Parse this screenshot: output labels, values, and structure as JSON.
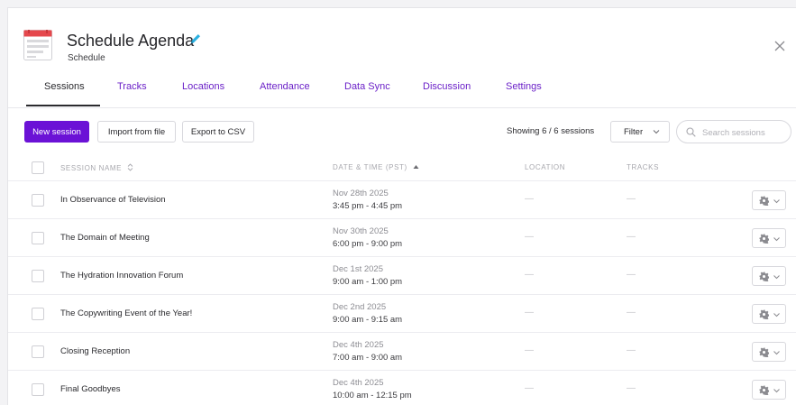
{
  "header": {
    "title": "Schedule Agenda",
    "subtitle": "Schedule"
  },
  "tabs": [
    {
      "label": "Sessions",
      "active": true
    },
    {
      "label": "Tracks"
    },
    {
      "label": "Locations"
    },
    {
      "label": "Attendance"
    },
    {
      "label": "Data Sync"
    },
    {
      "label": "Discussion"
    },
    {
      "label": "Settings"
    }
  ],
  "toolbar": {
    "new_label": "New session",
    "import_label": "Import from file",
    "export_label": "Export to CSV",
    "showing": "Showing 6 / 6 sessions",
    "filter_label": "Filter",
    "search_placeholder": "Search sessions"
  },
  "table": {
    "columns": {
      "name": "SESSION NAME",
      "date": "DATE & TIME (PST)",
      "location": "LOCATION",
      "tracks": "TRACKS"
    },
    "rows": [
      {
        "name": "In Observance of Television",
        "date": "Nov 28th 2025",
        "time": "3:45 pm - 4:45 pm",
        "location": "—",
        "tracks": "—"
      },
      {
        "name": "The Domain of Meeting",
        "date": "Nov 30th 2025",
        "time": "6:00 pm - 9:00 pm",
        "location": "—",
        "tracks": "—"
      },
      {
        "name": "The Hydration Innovation Forum",
        "date": "Dec 1st 2025",
        "time": "9:00 am - 1:00 pm",
        "location": "—",
        "tracks": "—"
      },
      {
        "name": "The Copywriting Event of the Year!",
        "date": "Dec 2nd 2025",
        "time": "9:00 am - 9:15 am",
        "location": "—",
        "tracks": "—"
      },
      {
        "name": "Closing Reception",
        "date": "Dec 4th 2025",
        "time": "7:00 am - 9:00 am",
        "location": "—",
        "tracks": "—"
      },
      {
        "name": "Final Goodbyes",
        "date": "Dec 4th 2025",
        "time": "10:00 am - 12:15 pm",
        "location": "—",
        "tracks": "—"
      }
    ]
  },
  "colors": {
    "accent": "#6b12d6",
    "app_icon": "#e5484d",
    "edit_icon": "#2bb0e0"
  },
  "icons": [
    "calendar-app-icon",
    "pencil-icon",
    "close-icon",
    "chevron-down-icon",
    "search-icon",
    "gear-icon",
    "sort-icon",
    "sort-asc-icon"
  ]
}
